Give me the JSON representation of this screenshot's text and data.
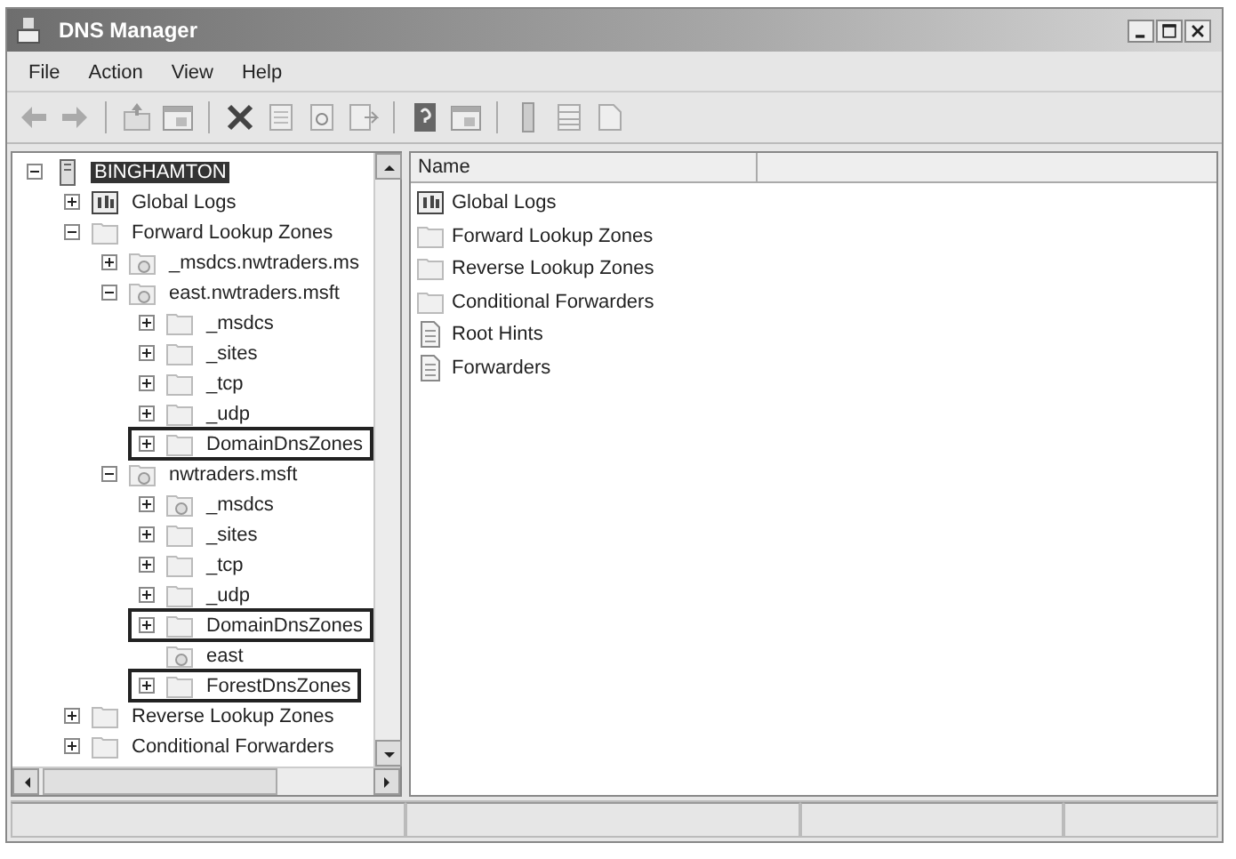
{
  "window": {
    "title": "DNS Manager"
  },
  "menu": [
    "File",
    "Action",
    "View",
    "Help"
  ],
  "toolbar": [
    {
      "kind": "back"
    },
    {
      "kind": "forward"
    },
    {
      "kind": "sep"
    },
    {
      "kind": "up"
    },
    {
      "kind": "console"
    },
    {
      "kind": "sep"
    },
    {
      "kind": "delete"
    },
    {
      "kind": "properties"
    },
    {
      "kind": "refresh"
    },
    {
      "kind": "export"
    },
    {
      "kind": "sep"
    },
    {
      "kind": "help"
    },
    {
      "kind": "console"
    },
    {
      "kind": "sep"
    },
    {
      "kind": "server"
    },
    {
      "kind": "list"
    },
    {
      "kind": "doc"
    }
  ],
  "tree": [
    {
      "label": "BINGHAMTON",
      "kind": "server",
      "selected": true,
      "outlined": false,
      "expanded": true,
      "children": [
        {
          "label": "Global Logs",
          "kind": "log",
          "selected": false,
          "outlined": false,
          "expanded": false
        },
        {
          "label": "Forward Lookup Zones",
          "kind": "folder",
          "selected": false,
          "outlined": false,
          "expanded": true,
          "children": [
            {
              "label": "_msdcs.nwtraders.ms",
              "kind": "zone",
              "selected": false,
              "outlined": false,
              "expanded": false
            },
            {
              "label": "east.nwtraders.msft",
              "kind": "zone",
              "selected": false,
              "outlined": false,
              "expanded": true,
              "children": [
                {
                  "label": "_msdcs",
                  "kind": "folder",
                  "selected": false,
                  "outlined": false,
                  "expanded": false
                },
                {
                  "label": "_sites",
                  "kind": "folder",
                  "selected": false,
                  "outlined": false,
                  "expanded": false
                },
                {
                  "label": "_tcp",
                  "kind": "folder",
                  "selected": false,
                  "outlined": false,
                  "expanded": false
                },
                {
                  "label": "_udp",
                  "kind": "folder",
                  "selected": false,
                  "outlined": false,
                  "expanded": false
                },
                {
                  "label": "DomainDnsZones",
                  "kind": "folder",
                  "selected": false,
                  "outlined": true,
                  "expanded": false
                }
              ]
            },
            {
              "label": "nwtraders.msft",
              "kind": "zone",
              "selected": false,
              "outlined": false,
              "expanded": true,
              "children": [
                {
                  "label": "_msdcs",
                  "kind": "zone",
                  "selected": false,
                  "outlined": false,
                  "expanded": false
                },
                {
                  "label": "_sites",
                  "kind": "folder",
                  "selected": false,
                  "outlined": false,
                  "expanded": false
                },
                {
                  "label": "_tcp",
                  "kind": "folder",
                  "selected": false,
                  "outlined": false,
                  "expanded": false
                },
                {
                  "label": "_udp",
                  "kind": "folder",
                  "selected": false,
                  "outlined": false,
                  "expanded": false
                },
                {
                  "label": "DomainDnsZones",
                  "kind": "folder",
                  "selected": false,
                  "outlined": true,
                  "expanded": false
                },
                {
                  "label": "east",
                  "kind": "zone",
                  "selected": false,
                  "outlined": false
                },
                {
                  "label": "ForestDnsZones",
                  "kind": "folder",
                  "selected": false,
                  "outlined": true,
                  "expanded": false
                }
              ]
            }
          ]
        },
        {
          "label": "Reverse Lookup Zones",
          "kind": "folder",
          "selected": false,
          "outlined": false,
          "expanded": false
        },
        {
          "label": "Conditional Forwarders",
          "kind": "folder",
          "selected": false,
          "outlined": false,
          "expanded": false
        }
      ]
    }
  ],
  "list": {
    "columns": [
      "Name"
    ],
    "items": [
      {
        "label": "Global Logs",
        "kind": "log"
      },
      {
        "label": "Forward Lookup Zones",
        "kind": "folder"
      },
      {
        "label": "Reverse Lookup Zones",
        "kind": "folder"
      },
      {
        "label": "Conditional Forwarders",
        "kind": "folder"
      },
      {
        "label": "Root Hints",
        "kind": "doc"
      },
      {
        "label": "Forwarders",
        "kind": "doc"
      }
    ]
  }
}
